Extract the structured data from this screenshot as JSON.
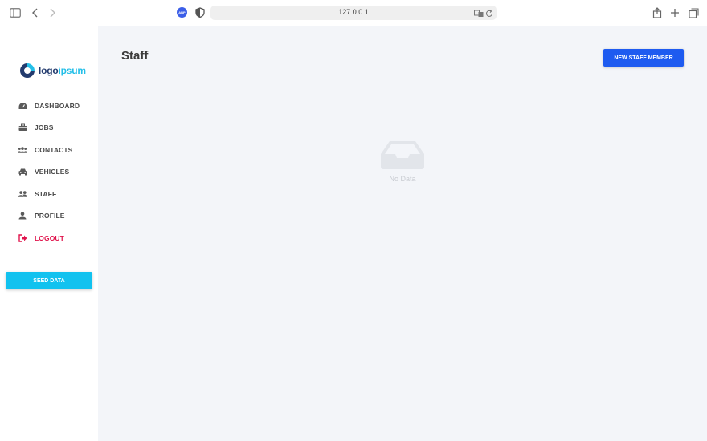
{
  "browser": {
    "url": "127.0.0.1",
    "extension_badge": "ABP"
  },
  "brand": {
    "logo_part1": "logo",
    "logo_part2": "ipsum",
    "accent": "#24bfe8"
  },
  "sidebar": {
    "items": [
      {
        "label": "DASHBOARD",
        "icon": "dashboard-icon"
      },
      {
        "label": "JOBS",
        "icon": "briefcase-icon"
      },
      {
        "label": "CONTACTS",
        "icon": "users-icon"
      },
      {
        "label": "VEHICLES",
        "icon": "car-icon"
      },
      {
        "label": "STAFF",
        "icon": "user-group-icon"
      },
      {
        "label": "PROFILE",
        "icon": "user-icon"
      },
      {
        "label": "LOGOUT",
        "icon": "logout-icon",
        "color": "#e0144c"
      }
    ],
    "seed_button": "SEED DATA"
  },
  "main": {
    "title": "Staff",
    "new_button": "NEW STAFF MEMBER",
    "empty_text": "No Data"
  }
}
